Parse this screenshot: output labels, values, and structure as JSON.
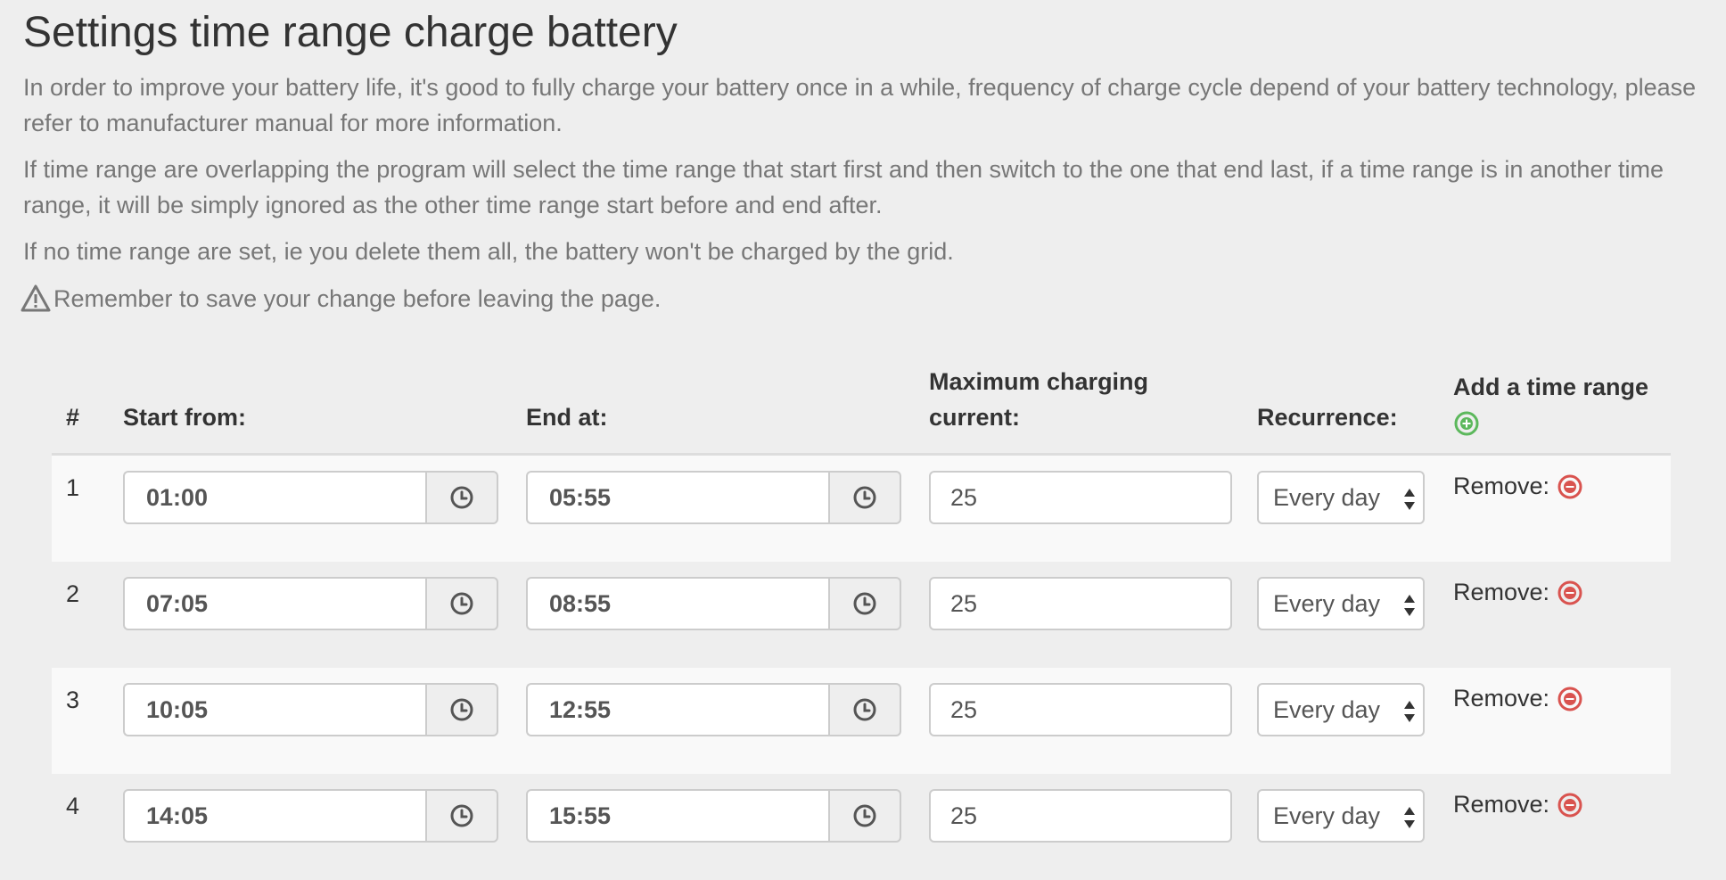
{
  "page": {
    "title": "Settings time range charge battery",
    "paragraphs": [
      "In order to improve your battery life, it's good to fully charge your battery once in a while, frequency of charge cycle depend of your battery technology, please refer to manufacturer manual for more information.",
      "If time range are overlapping the program will select the time range that start first and then switch to the one that end last, if a time range is in another time range, it will be simply ignored as the other time range start before and end after.",
      "If no time range are set, ie you delete them all, the battery won't be charged by the grid."
    ],
    "warning": "Remember to save your change before leaving the page.",
    "warning_icon": "warning-triangle-icon"
  },
  "table": {
    "headers": {
      "index": "#",
      "start": "Start from:",
      "end": "End at:",
      "current": "Maximum charging current:",
      "recurrence": "Recurrence:",
      "add": "Add a time range"
    },
    "remove_label": "Remove:",
    "rows": [
      {
        "index": "1",
        "start": "01:00",
        "end": "05:55",
        "current": "25",
        "recurrence": "Every day"
      },
      {
        "index": "2",
        "start": "07:05",
        "end": "08:55",
        "current": "25",
        "recurrence": "Every day"
      },
      {
        "index": "3",
        "start": "10:05",
        "end": "12:55",
        "current": "25",
        "recurrence": "Every day"
      },
      {
        "index": "4",
        "start": "14:05",
        "end": "15:55",
        "current": "25",
        "recurrence": "Every day"
      }
    ]
  },
  "colors": {
    "add": "#5cb85c",
    "remove": "#d9534f",
    "muted_text": "#777777"
  }
}
